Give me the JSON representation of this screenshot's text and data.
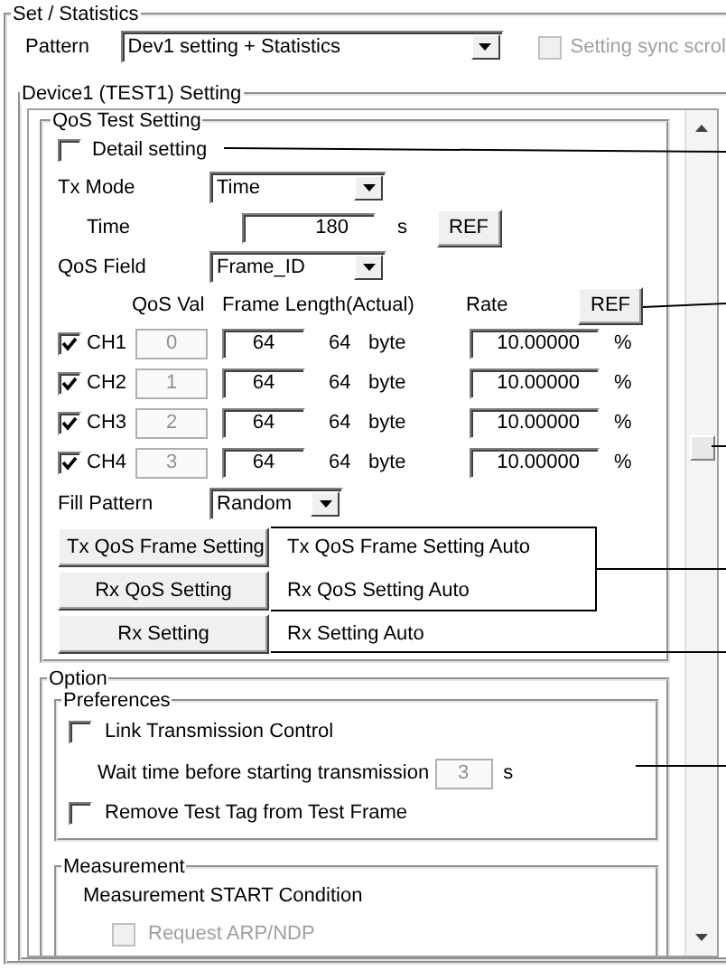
{
  "settings_group": {
    "title": "Set / Statistics"
  },
  "pattern": {
    "label": "Pattern",
    "value": "Dev1 setting + Statistics"
  },
  "sync_scroll": {
    "label": "Setting sync scrol",
    "checked": false,
    "disabled": true
  },
  "device_group": {
    "title": "Device1 (TEST1) Setting"
  },
  "qos_test": {
    "title": "QoS Test Setting",
    "detail": {
      "label": "Detail setting",
      "checked": false
    },
    "tx_mode": {
      "label": "Tx Mode",
      "value": "Time"
    },
    "time": {
      "label": "Time",
      "value": "180",
      "unit": "s",
      "button": "REF"
    },
    "qos_field": {
      "label": "QoS Field",
      "value": "Frame_ID"
    },
    "columns": [
      "QoS Val",
      "Frame Length(Actual)",
      "Rate"
    ],
    "rate_button": "REF",
    "channels": [
      {
        "name": "CH1",
        "checked": true,
        "qos_value": "0",
        "qos_value_disabled": true,
        "frame_length": "64",
        "actual_length": "64",
        "unit": "byte",
        "rate": "10.00000",
        "rate_unit": "%"
      },
      {
        "name": "CH2",
        "checked": true,
        "qos_value": "1",
        "qos_value_disabled": true,
        "frame_length": "64",
        "actual_length": "64",
        "unit": "byte",
        "rate": "10.00000",
        "rate_unit": "%"
      },
      {
        "name": "CH3",
        "checked": true,
        "qos_value": "2",
        "qos_value_disabled": true,
        "frame_length": "64",
        "actual_length": "64",
        "unit": "byte",
        "rate": "10.00000",
        "rate_unit": "%"
      },
      {
        "name": "CH4",
        "checked": true,
        "qos_value": "3",
        "qos_value_disabled": true,
        "frame_length": "64",
        "actual_length": "64",
        "unit": "byte",
        "rate": "10.00000",
        "rate_unit": "%"
      }
    ],
    "fill_pattern": {
      "label": "Fill Pattern",
      "value": "Random"
    },
    "actions": [
      {
        "button": "Tx QoS Frame Setting",
        "status": "Tx QoS Frame Setting Auto"
      },
      {
        "button": "Rx QoS Setting",
        "status": "Rx QoS Setting Auto"
      },
      {
        "button": "Rx Setting",
        "status": "Rx Setting Auto"
      }
    ]
  },
  "option": {
    "title": "Option",
    "preferences": {
      "title": "Preferences",
      "link_control": {
        "label": "Link Transmission Control",
        "checked": false
      },
      "wait_time": {
        "label": "Wait time before starting transmission",
        "value": "3",
        "unit": "s",
        "disabled": true
      },
      "remove_tag": {
        "label": "Remove Test Tag from Test Frame",
        "checked": false
      }
    },
    "measurement": {
      "title": "Measurement",
      "heading": "Measurement START Condition",
      "request_arp": {
        "label": "Request ARP/NDP",
        "checked": false,
        "disabled": true
      }
    }
  }
}
